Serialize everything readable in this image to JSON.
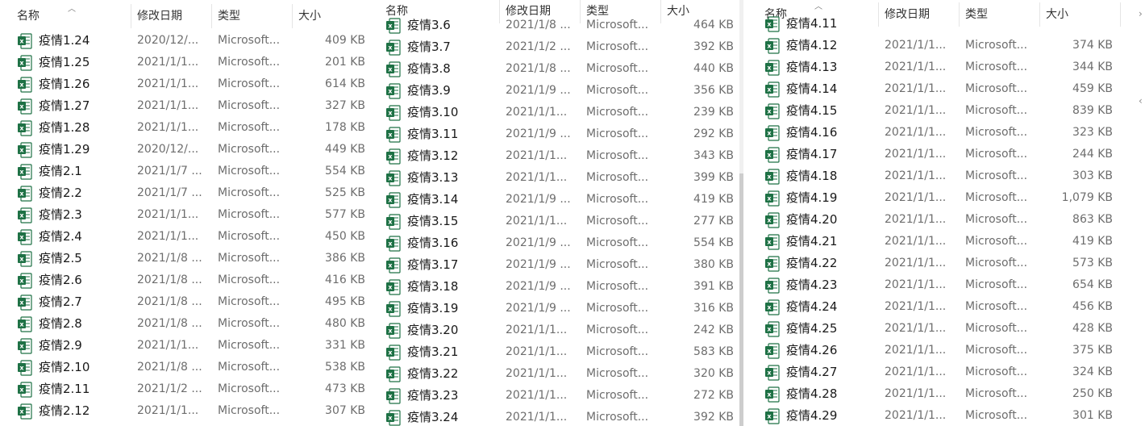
{
  "columns": {
    "name": "名称",
    "date": "修改日期",
    "type": "类型",
    "size": "大小"
  },
  "panes": [
    {
      "files": [
        {
          "name": "疫情1.24",
          "date": "2020/12/...",
          "type": "Microsoft...",
          "size": "409 KB"
        },
        {
          "name": "疫情1.25",
          "date": "2021/1/1...",
          "type": "Microsoft...",
          "size": "201 KB"
        },
        {
          "name": "疫情1.26",
          "date": "2021/1/1...",
          "type": "Microsoft...",
          "size": "614 KB"
        },
        {
          "name": "疫情1.27",
          "date": "2021/1/1...",
          "type": "Microsoft...",
          "size": "327 KB"
        },
        {
          "name": "疫情1.28",
          "date": "2021/1/1...",
          "type": "Microsoft...",
          "size": "178 KB"
        },
        {
          "name": "疫情1.29",
          "date": "2020/12/...",
          "type": "Microsoft...",
          "size": "449 KB"
        },
        {
          "name": "疫情2.1",
          "date": "2021/1/7 ...",
          "type": "Microsoft...",
          "size": "554 KB"
        },
        {
          "name": "疫情2.2",
          "date": "2021/1/7 ...",
          "type": "Microsoft...",
          "size": "525 KB"
        },
        {
          "name": "疫情2.3",
          "date": "2021/1/1...",
          "type": "Microsoft...",
          "size": "577 KB"
        },
        {
          "name": "疫情2.4",
          "date": "2021/1/1...",
          "type": "Microsoft...",
          "size": "450 KB"
        },
        {
          "name": "疫情2.5",
          "date": "2021/1/8 ...",
          "type": "Microsoft...",
          "size": "386 KB"
        },
        {
          "name": "疫情2.6",
          "date": "2021/1/8 ...",
          "type": "Microsoft...",
          "size": "416 KB"
        },
        {
          "name": "疫情2.7",
          "date": "2021/1/8 ...",
          "type": "Microsoft...",
          "size": "495 KB"
        },
        {
          "name": "疫情2.8",
          "date": "2021/1/8 ...",
          "type": "Microsoft...",
          "size": "480 KB"
        },
        {
          "name": "疫情2.9",
          "date": "2021/1/1...",
          "type": "Microsoft...",
          "size": "331 KB"
        },
        {
          "name": "疫情2.10",
          "date": "2021/1/8 ...",
          "type": "Microsoft...",
          "size": "538 KB"
        },
        {
          "name": "疫情2.11",
          "date": "2021/1/2 ...",
          "type": "Microsoft...",
          "size": "473 KB"
        },
        {
          "name": "疫情2.12",
          "date": "2021/1/1...",
          "type": "Microsoft...",
          "size": "307 KB"
        }
      ]
    },
    {
      "files": [
        {
          "name": "疫情3.6",
          "date": "2021/1/8 ...",
          "type": "Microsoft...",
          "size": "464 KB"
        },
        {
          "name": "疫情3.7",
          "date": "2021/1/2 ...",
          "type": "Microsoft...",
          "size": "392 KB"
        },
        {
          "name": "疫情3.8",
          "date": "2021/1/8 ...",
          "type": "Microsoft...",
          "size": "440 KB"
        },
        {
          "name": "疫情3.9",
          "date": "2021/1/9 ...",
          "type": "Microsoft...",
          "size": "356 KB"
        },
        {
          "name": "疫情3.10",
          "date": "2021/1/1...",
          "type": "Microsoft...",
          "size": "239 KB"
        },
        {
          "name": "疫情3.11",
          "date": "2021/1/9 ...",
          "type": "Microsoft...",
          "size": "292 KB"
        },
        {
          "name": "疫情3.12",
          "date": "2021/1/1...",
          "type": "Microsoft...",
          "size": "343 KB"
        },
        {
          "name": "疫情3.13",
          "date": "2021/1/1...",
          "type": "Microsoft...",
          "size": "399 KB"
        },
        {
          "name": "疫情3.14",
          "date": "2021/1/9 ...",
          "type": "Microsoft...",
          "size": "419 KB"
        },
        {
          "name": "疫情3.15",
          "date": "2021/1/1...",
          "type": "Microsoft...",
          "size": "277 KB"
        },
        {
          "name": "疫情3.16",
          "date": "2021/1/9 ...",
          "type": "Microsoft...",
          "size": "554 KB"
        },
        {
          "name": "疫情3.17",
          "date": "2021/1/9 ...",
          "type": "Microsoft...",
          "size": "380 KB"
        },
        {
          "name": "疫情3.18",
          "date": "2021/1/9 ...",
          "type": "Microsoft...",
          "size": "391 KB"
        },
        {
          "name": "疫情3.19",
          "date": "2021/1/9 ...",
          "type": "Microsoft...",
          "size": "316 KB"
        },
        {
          "name": "疫情3.20",
          "date": "2021/1/1...",
          "type": "Microsoft...",
          "size": "242 KB"
        },
        {
          "name": "疫情3.21",
          "date": "2021/1/1...",
          "type": "Microsoft...",
          "size": "583 KB"
        },
        {
          "name": "疫情3.22",
          "date": "2021/1/1...",
          "type": "Microsoft...",
          "size": "320 KB"
        },
        {
          "name": "疫情3.23",
          "date": "2021/1/1...",
          "type": "Microsoft...",
          "size": "272 KB"
        },
        {
          "name": "疫情3.24",
          "date": "2021/1/1...",
          "type": "Microsoft...",
          "size": "392 KB"
        }
      ]
    },
    {
      "files": [
        {
          "name": "疫情4.11",
          "date": "",
          "type": "",
          "size": ""
        },
        {
          "name": "疫情4.12",
          "date": "2021/1/1...",
          "type": "Microsoft...",
          "size": "374 KB"
        },
        {
          "name": "疫情4.13",
          "date": "2021/1/1...",
          "type": "Microsoft...",
          "size": "344 KB"
        },
        {
          "name": "疫情4.14",
          "date": "2021/1/1...",
          "type": "Microsoft...",
          "size": "459 KB"
        },
        {
          "name": "疫情4.15",
          "date": "2021/1/1...",
          "type": "Microsoft...",
          "size": "839 KB"
        },
        {
          "name": "疫情4.16",
          "date": "2021/1/1...",
          "type": "Microsoft...",
          "size": "323 KB"
        },
        {
          "name": "疫情4.17",
          "date": "2021/1/1...",
          "type": "Microsoft...",
          "size": "244 KB"
        },
        {
          "name": "疫情4.18",
          "date": "2021/1/1...",
          "type": "Microsoft...",
          "size": "303 KB"
        },
        {
          "name": "疫情4.19",
          "date": "2021/1/1...",
          "type": "Microsoft...",
          "size": "1,079 KB"
        },
        {
          "name": "疫情4.20",
          "date": "2021/1/1...",
          "type": "Microsoft...",
          "size": "863 KB"
        },
        {
          "name": "疫情4.21",
          "date": "2021/1/1...",
          "type": "Microsoft...",
          "size": "419 KB"
        },
        {
          "name": "疫情4.22",
          "date": "2021/1/1...",
          "type": "Microsoft...",
          "size": "573 KB"
        },
        {
          "name": "疫情4.23",
          "date": "2021/1/1...",
          "type": "Microsoft...",
          "size": "654 KB"
        },
        {
          "name": "疫情4.24",
          "date": "2021/1/1...",
          "type": "Microsoft...",
          "size": "456 KB"
        },
        {
          "name": "疫情4.25",
          "date": "2021/1/1...",
          "type": "Microsoft...",
          "size": "428 KB"
        },
        {
          "name": "疫情4.26",
          "date": "2021/1/1...",
          "type": "Microsoft...",
          "size": "375 KB"
        },
        {
          "name": "疫情4.27",
          "date": "2021/1/1...",
          "type": "Microsoft...",
          "size": "324 KB"
        },
        {
          "name": "疫情4.28",
          "date": "2021/1/1...",
          "type": "Microsoft...",
          "size": "250 KB"
        },
        {
          "name": "疫情4.29",
          "date": "2021/1/1...",
          "type": "Microsoft...",
          "size": "301 KB"
        }
      ]
    }
  ],
  "colors": {
    "excel_green": "#1e7145",
    "excel_light": "#33a36b"
  }
}
